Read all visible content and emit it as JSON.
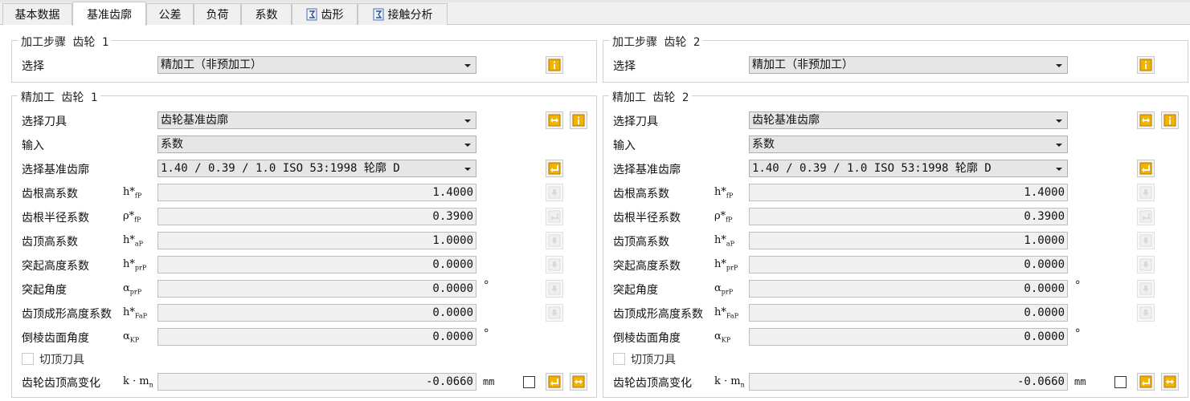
{
  "tabs": [
    {
      "label": "基本数据"
    },
    {
      "label": "基准齿廓",
      "active": true
    },
    {
      "label": "公差"
    },
    {
      "label": "负荷"
    },
    {
      "label": "系数"
    },
    {
      "label": "齿形",
      "icon": "sigma-doc-icon"
    },
    {
      "label": "接触分析",
      "icon": "sigma-doc-icon"
    }
  ],
  "gear1": {
    "process_title": "加工步骤 齿轮 1",
    "process_label": "选择",
    "process_value": "精加工（非预加工）",
    "finish_title": "精加工 齿轮 1",
    "tool_label": "选择刀具",
    "tool_value": "齿轮基准齿廓",
    "input_label": "输入",
    "input_value": "系数",
    "profile_label": "选择基准齿廓",
    "profile_value": "1.40 / 0.39 / 1.0 ISO 53:1998 轮廓 D",
    "rows": [
      {
        "label": "齿根高系数",
        "sym": "h*",
        "sub": "fP",
        "value": "1.4000",
        "unit": ""
      },
      {
        "label": "齿根半径系数",
        "sym": "ρ*",
        "sub": "fP",
        "value": "0.3900",
        "unit": ""
      },
      {
        "label": "齿顶高系数",
        "sym": "h*",
        "sub": "aP",
        "value": "1.0000",
        "unit": ""
      },
      {
        "label": "突起高度系数",
        "sym": "h*",
        "sub": "prP",
        "value": "0.0000",
        "unit": ""
      },
      {
        "label": "突起角度",
        "sym": "α",
        "sub": "prP",
        "value": "0.0000",
        "unit": "°"
      },
      {
        "label": "齿顶成形高度系数",
        "sym": "h*",
        "sub": "FaP",
        "value": "0.0000",
        "unit": ""
      },
      {
        "label": "倒棱齿面角度",
        "sym": "α",
        "sub": "KP",
        "value": "0.0000",
        "unit": "°"
      }
    ],
    "tip_cut_label": "切顶刀具",
    "addendum_label": "齿轮齿顶高变化",
    "addendum_sym": "k · m",
    "addendum_sub": "n",
    "addendum_value": "-0.0660",
    "addendum_unit": "mm"
  },
  "gear2": {
    "process_title": "加工步骤 齿轮 2",
    "process_label": "选择",
    "process_value": "精加工（非预加工）",
    "finish_title": "精加工 齿轮 2",
    "tool_label": "选择刀具",
    "tool_value": "齿轮基准齿廓",
    "input_label": "输入",
    "input_value": "系数",
    "profile_label": "选择基准齿廓",
    "profile_value": "1.40 / 0.39 / 1.0 ISO 53:1998 轮廓 D",
    "rows": [
      {
        "label": "齿根高系数",
        "sym": "h*",
        "sub": "fP",
        "value": "1.4000",
        "unit": ""
      },
      {
        "label": "齿根半径系数",
        "sym": "ρ*",
        "sub": "fP",
        "value": "0.3900",
        "unit": ""
      },
      {
        "label": "齿顶高系数",
        "sym": "h*",
        "sub": "aP",
        "value": "1.0000",
        "unit": ""
      },
      {
        "label": "突起高度系数",
        "sym": "h*",
        "sub": "prP",
        "value": "0.0000",
        "unit": ""
      },
      {
        "label": "突起角度",
        "sym": "α",
        "sub": "prP",
        "value": "0.0000",
        "unit": "°"
      },
      {
        "label": "齿顶成形高度系数",
        "sym": "h*",
        "sub": "FaP",
        "value": "0.0000",
        "unit": ""
      },
      {
        "label": "倒棱齿面角度",
        "sym": "α",
        "sub": "KP",
        "value": "0.0000",
        "unit": "°"
      }
    ],
    "tip_cut_label": "切顶刀具",
    "addendum_label": "齿轮齿顶高变化",
    "addendum_sym": "k · m",
    "addendum_sub": "n",
    "addendum_value": "-0.0660",
    "addendum_unit": "mm"
  },
  "colors": {
    "accent": "#f0a800",
    "info": "#e8a000",
    "disabled": "#bcbcbc"
  }
}
